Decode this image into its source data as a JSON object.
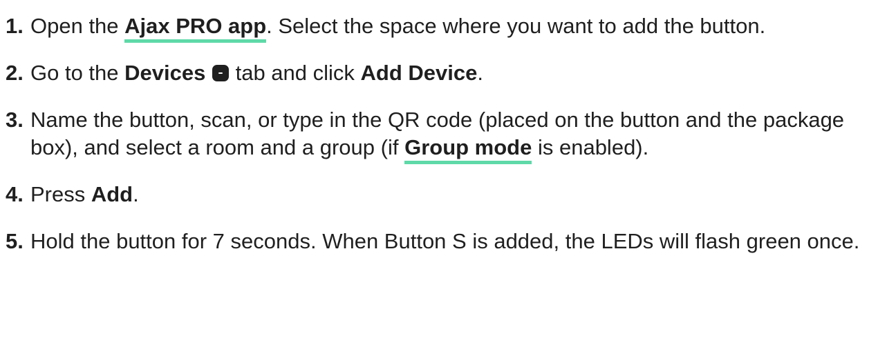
{
  "steps": [
    {
      "num": "1.",
      "t1": "Open the ",
      "link1": "Ajax PRO app",
      "t2": ". Select the space where you want to add the button."
    },
    {
      "num": "2.",
      "t1": "Go to the ",
      "b1": "Devices",
      "icon": "devices-tab-icon",
      "t2": " tab and click ",
      "b2": "Add Device",
      "t3": "."
    },
    {
      "num": "3.",
      "t1": "Name the button, scan, or type in the QR code (placed on the button and the package box), and select a room and a group (if ",
      "link1": "Group mode",
      "t2": " is enabled)."
    },
    {
      "num": "4.",
      "t1": "Press ",
      "b1": "Add",
      "t2": "."
    },
    {
      "num": "5.",
      "t1": "Hold the button for 7 seconds. When Button S is added, the LEDs will flash green once."
    }
  ],
  "colors": {
    "text": "#1f1f1f",
    "link_underline": "#5fd9a8"
  }
}
